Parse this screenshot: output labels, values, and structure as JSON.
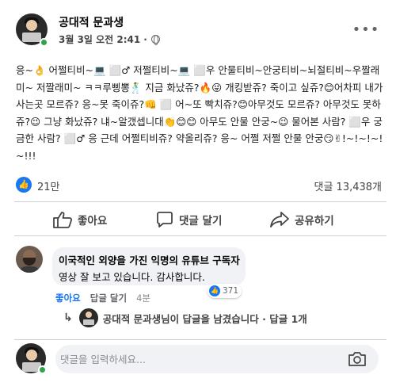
{
  "post": {
    "author": "공대적 문과생",
    "date": "3월 3일 오전 2:41",
    "separator": "·",
    "more_label": "•••",
    "text": "응~👌 어쩔티비~💻 ⬜♂ 저쩔티비~💻 ⬜우 안물티비~안궁티비~뇌절티비~우짤래미~ 저짤래미~ ㅋㅋ루삥뽕🕺 지금 화났쥬?🔥😜 개킹받쥬? 죽이고 싶쥬?😊어차피 내가 사는곳 모르쥬? 응~못 죽이쥬?👊 ⬜ 어~또 빡치쥬?😊아무것도 모르쥬? 아무것도 못하쥬?😉 그냥 화났쥬? 냬~알갰셉니대👏😊😊 아무도 안물 안궁~😉 물어본 사람? ⬜우 궁금한 사람? ⬜♂ 응 근데 어쩔티비쥬? 약올리쥬? 응~ 어쩔 저쩔 안물 안궁😏✌!~!~!~!~!!!"
  },
  "stats": {
    "like_count": "21만",
    "comment_count": "댓글 13,438개"
  },
  "actions": {
    "like_label": "좋아요",
    "comment_label": "댓글 달기",
    "share_label": "공유하기"
  },
  "comment": {
    "author": "이국적인 외양을 가진 익명의 유튜브 구독자",
    "text": "영상 잘 보고 있습니다. 감사합니다.",
    "reaction_count": "371",
    "like_label": "좋아요",
    "reply_label": "답글 달기",
    "time": "4분",
    "reply_summary": "공대적 문과생님이 답글을 남겼습니다 · 답글 1개"
  },
  "compose": {
    "placeholder": "댓글을 입력하세요..."
  },
  "colors": {
    "accent": "#1877f2",
    "online": "#31a24c",
    "bubble": "#f0f2f5"
  }
}
